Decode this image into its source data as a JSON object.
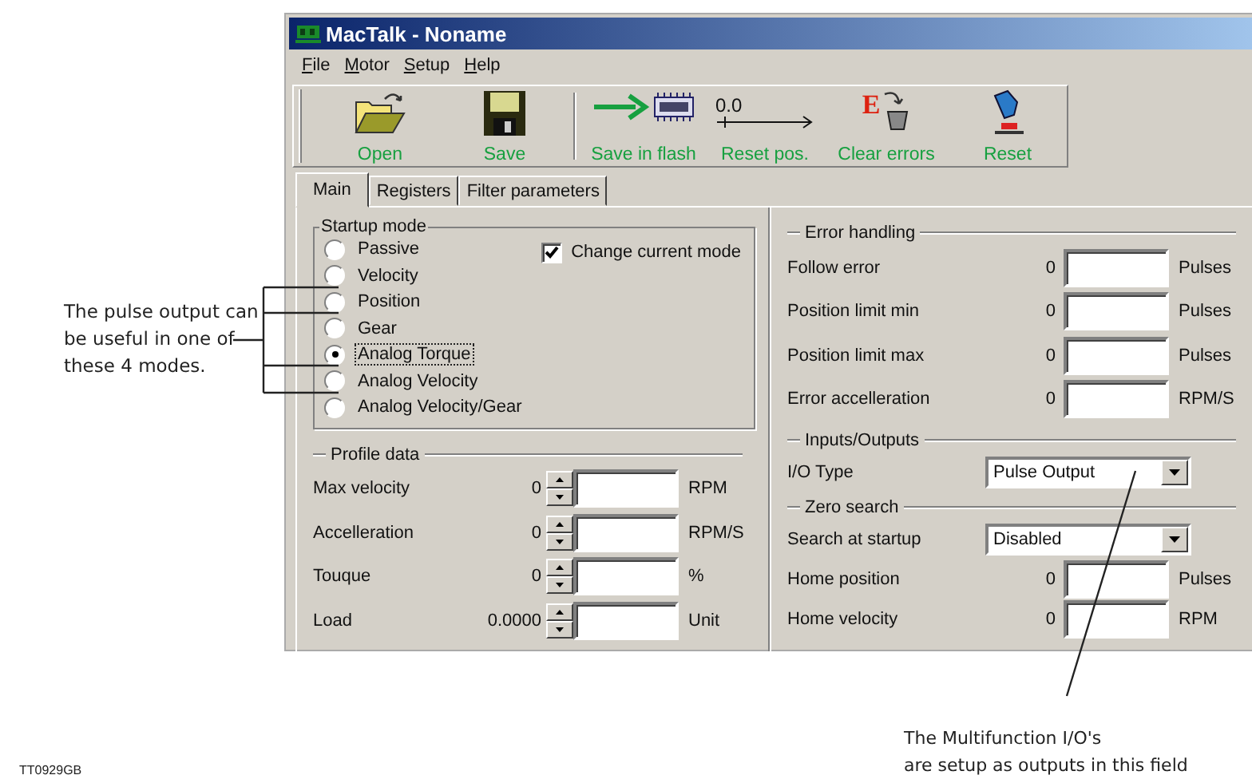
{
  "window": {
    "title": "MacTalk - Noname"
  },
  "menu": [
    "File",
    "Motor",
    "Setup",
    "Help"
  ],
  "toolbar": [
    {
      "kind": "open",
      "label": "Open"
    },
    {
      "kind": "save",
      "label": "Save"
    },
    {
      "kind": "flash",
      "label": "Save in flash"
    },
    {
      "kind": "reset-pos",
      "label": "Reset pos.",
      "reading": "0.0"
    },
    {
      "kind": "clear",
      "label": "Clear errors",
      "glyph": "E"
    },
    {
      "kind": "reset",
      "label": "Reset"
    }
  ],
  "tabs": [
    {
      "label": "Main",
      "selected": true
    },
    {
      "label": "Registers",
      "selected": false
    },
    {
      "label": "Filter parameters",
      "selected": false
    }
  ],
  "startup_mode": {
    "title": "Startup mode",
    "options": [
      {
        "label": "Passive",
        "selected": false,
        "focused": false
      },
      {
        "label": "Velocity",
        "selected": false,
        "focused": false
      },
      {
        "label": "Position",
        "selected": false,
        "focused": false
      },
      {
        "label": "Gear",
        "selected": false,
        "focused": false
      },
      {
        "label": "Analog Torque",
        "selected": true,
        "focused": true
      },
      {
        "label": "Analog Velocity",
        "selected": false,
        "focused": false
      },
      {
        "label": "Analog Velocity/Gear",
        "selected": false,
        "focused": false
      }
    ],
    "change_current_mode": {
      "label": "Change current mode",
      "checked": true
    }
  },
  "profile_data": {
    "title": "Profile data",
    "rows": [
      {
        "label": "Max velocity",
        "reading": "0",
        "unit": "RPM"
      },
      {
        "label": "Accelleration",
        "reading": "0",
        "unit": "RPM/S"
      },
      {
        "label": "Touque",
        "reading": "0",
        "unit": "%"
      },
      {
        "label": "Load",
        "reading": "0.0000",
        "unit": "Unit"
      }
    ]
  },
  "error_handling": {
    "title": "Error handling",
    "rows": [
      {
        "label": "Follow error",
        "reading": "0",
        "unit": "Pulses"
      },
      {
        "label": "Position limit min",
        "reading": "0",
        "unit": "Pulses"
      },
      {
        "label": "Position limit max",
        "reading": "0",
        "unit": "Pulses"
      },
      {
        "label": "Error accelleration",
        "reading": "0",
        "unit": "RPM/S"
      }
    ]
  },
  "inputs_outputs": {
    "title": "Inputs/Outputs",
    "label": "I/O Type",
    "value": "Pulse Output"
  },
  "zero_search": {
    "title": "Zero search",
    "label": "Search at startup",
    "value": "Disabled",
    "rows": [
      {
        "label": "Home position",
        "reading": "0",
        "unit": "Pulses"
      },
      {
        "label": "Home velocity",
        "reading": "0",
        "unit": "RPM"
      }
    ]
  },
  "annotations": {
    "modes_note": "The pulse output can be useful in one of these 4 modes.",
    "io_note_lines": [
      "The Multifunction I/O's",
      "are setup as outputs in this field"
    ],
    "figure_id": "TT0929GB"
  }
}
